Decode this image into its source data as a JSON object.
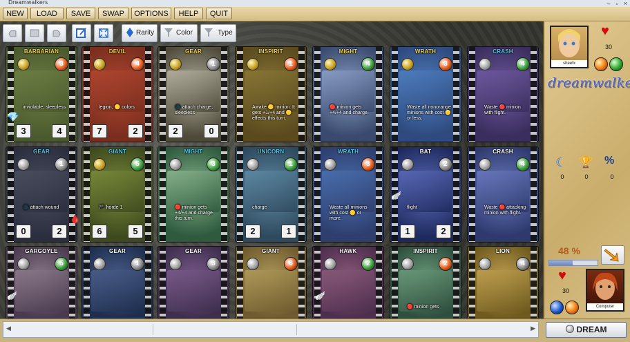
{
  "window": {
    "title": "Dreamwalkers"
  },
  "menu": [
    "NEW",
    "LOAD",
    "SAVE",
    "SWAP",
    "OPTIONS",
    "HELP",
    "QUIT"
  ],
  "toolbar": {
    "rarity_label": "Rarity",
    "color_label": "Color",
    "type_label": "Type"
  },
  "cards": [
    {
      "name": "BARBARIAN",
      "name_color": "#f0d040",
      "level": "3",
      "lvl_color": "#e85a18",
      "cost_orb": "gold",
      "bg": "#4a5a2e",
      "art": "#6e7f44",
      "text": "inviolable, sleepless",
      "attack": "3",
      "defense": "4"
    },
    {
      "name": "DEVIL",
      "name_color": "#f0d040",
      "level": "4",
      "lvl_color": "#e85a18",
      "cost_orb": "gold",
      "bg": "#7a2e1e",
      "art": "#b04630",
      "text": "legion, 🟡 colors",
      "attack": "7",
      "defense": "2"
    },
    {
      "name": "GEAR",
      "name_color": "#f0d040",
      "level": "1",
      "lvl_color": "#8a8a8a",
      "cost_orb": "gold",
      "bg": "#4d4a3a",
      "art": "#b7b2a0",
      "text": "🌑 attach charge, sleepless",
      "attack": "2",
      "defense": "0"
    },
    {
      "name": "INSPIRIT",
      "name_color": "#f0d040",
      "level": "1",
      "lvl_color": "#e85a18",
      "cost_orb": "gold",
      "bg": "#5a4a1e",
      "art": "#8a7836",
      "text": "Awake 🟡 minion. It gets +1/+4 and 🟡 effects this turn.",
      "attack": "",
      "defense": ""
    },
    {
      "name": "MIGHT",
      "name_color": "#f0d040",
      "level": "4",
      "lvl_color": "#3aa03a",
      "cost_orb": "gold",
      "bg": "#3a4a6e",
      "art": "#8ca0c8",
      "text": "🔴 minion gets +4/+4 and charge.",
      "attack": "",
      "defense": ""
    },
    {
      "name": "WRATH",
      "name_color": "#f0d040",
      "level": "3",
      "lvl_color": "#e85a18",
      "cost_orb": "gold",
      "bg": "#2e4a7e",
      "art": "#4f7fc0",
      "text": "Waste all nonorange minions with cost 🟡 or less.",
      "attack": "",
      "defense": ""
    },
    {
      "name": "CRASH",
      "name_color": "#50c8e8",
      "level": "4",
      "lvl_color": "#3aa03a",
      "cost_orb": "grey",
      "bg": "#3a2e5e",
      "art": "#6f5aa0",
      "text": "Waste 🔴 minion with flight.",
      "attack": "",
      "defense": ""
    },
    {
      "name": "GEAR",
      "name_color": "#50c8e8",
      "level": "1",
      "lvl_color": "#8a8a8a",
      "cost_orb": "grey",
      "bg": "#2a2e3e",
      "art": "#4a4e5e",
      "text": "🌑 attach wound",
      "attack": "0",
      "defense": "2"
    },
    {
      "name": "GIANT",
      "name_color": "#50c8e8",
      "level": "5",
      "lvl_color": "#3aa03a",
      "cost_orb": "gold",
      "bg": "#3e4a1e",
      "art": "#7a8a3a",
      "text": "🏴 horde 1",
      "attack": "6",
      "defense": "5"
    },
    {
      "name": "MIGHT",
      "name_color": "#50c8e8",
      "level": "3",
      "lvl_color": "#3aa03a",
      "cost_orb": "grey",
      "bg": "#2e5a3e",
      "art": "#8ab48c",
      "text": "🔴 minion gets +4/+4 and charge this turn.",
      "attack": "",
      "defense": ""
    },
    {
      "name": "UNICORN",
      "name_color": "#50c8e8",
      "level": "1",
      "lvl_color": "#3aa03a",
      "cost_orb": "grey",
      "bg": "#2e4a5e",
      "art": "#5f8aa5",
      "text": "charge",
      "attack": "2",
      "defense": "1"
    },
    {
      "name": "WRATH",
      "name_color": "#50c8e8",
      "level": "3",
      "lvl_color": "#e85a18",
      "cost_orb": "grey",
      "bg": "#2e3e6e",
      "art": "#4a70b0",
      "text": "Waste all minions with cost 🟡 or more.",
      "attack": "",
      "defense": ""
    },
    {
      "name": "BAT",
      "name_color": "#ffffff",
      "level": "2",
      "lvl_color": "#8a8a8a",
      "cost_orb": "grey",
      "bg": "#1e2a5e",
      "art": "#5a6ab8",
      "text": "flight",
      "attack": "1",
      "defense": "2"
    },
    {
      "name": "CRASH",
      "name_color": "#ffffff",
      "level": "4",
      "lvl_color": "#3aa03a",
      "cost_orb": "grey",
      "bg": "#2e3a6e",
      "art": "#6a7ac0",
      "text": "Waste 🔴 attacking minion with flight.",
      "attack": "",
      "defense": ""
    },
    {
      "name": "GARGOYLE",
      "name_color": "#ffffff",
      "level": "5",
      "lvl_color": "#3aa03a",
      "cost_orb": "grey",
      "bg": "#4a3a4e",
      "art": "#8a7a8a",
      "text": "",
      "attack": "",
      "defense": ""
    },
    {
      "name": "GEAR",
      "name_color": "#ffffff",
      "level": "1",
      "lvl_color": "#8a8a8a",
      "cost_orb": "grey",
      "bg": "#1e2e4e",
      "art": "#4a5e8a",
      "text": "",
      "attack": "",
      "defense": ""
    },
    {
      "name": "GEAR",
      "name_color": "#ffffff",
      "level": "3",
      "lvl_color": "#8a8a8a",
      "cost_orb": "grey",
      "bg": "#3e2e4e",
      "art": "#7a5a8a",
      "text": "",
      "attack": "",
      "defense": ""
    },
    {
      "name": "GIANT",
      "name_color": "#ffffff",
      "level": "6",
      "lvl_color": "#e85a18",
      "cost_orb": "grey",
      "bg": "#6e5a2e",
      "art": "#b09a5a",
      "text": "",
      "attack": "",
      "defense": ""
    },
    {
      "name": "HAWK",
      "name_color": "#ffffff",
      "level": "2",
      "lvl_color": "#3aa03a",
      "cost_orb": "grey",
      "bg": "#4e2e4e",
      "art": "#8a5a7a",
      "text": "",
      "attack": "",
      "defense": ""
    },
    {
      "name": "INSPIRIT",
      "name_color": "#ffffff",
      "level": "2",
      "lvl_color": "#e85a18",
      "cost_orb": "grey",
      "bg": "#2e4e3e",
      "art": "#6a9a7a",
      "text": "🔴 minion gets",
      "attack": "",
      "defense": ""
    },
    {
      "name": "LION",
      "name_color": "#ffffff",
      "level": "4",
      "lvl_color": "#8a8a8a",
      "cost_orb": "grey",
      "bg": "#6e5a1e",
      "art": "#c0a050",
      "text": "",
      "attack": "",
      "defense": ""
    }
  ],
  "player": {
    "name": "sheefx",
    "life": "30"
  },
  "logo": "dreamwalkers",
  "counters": [
    "0",
    "0",
    "0"
  ],
  "progress": {
    "label": "48 %",
    "value": 0.48
  },
  "computer": {
    "name": "Computer",
    "life": "30"
  },
  "dream_button": "DREAM"
}
